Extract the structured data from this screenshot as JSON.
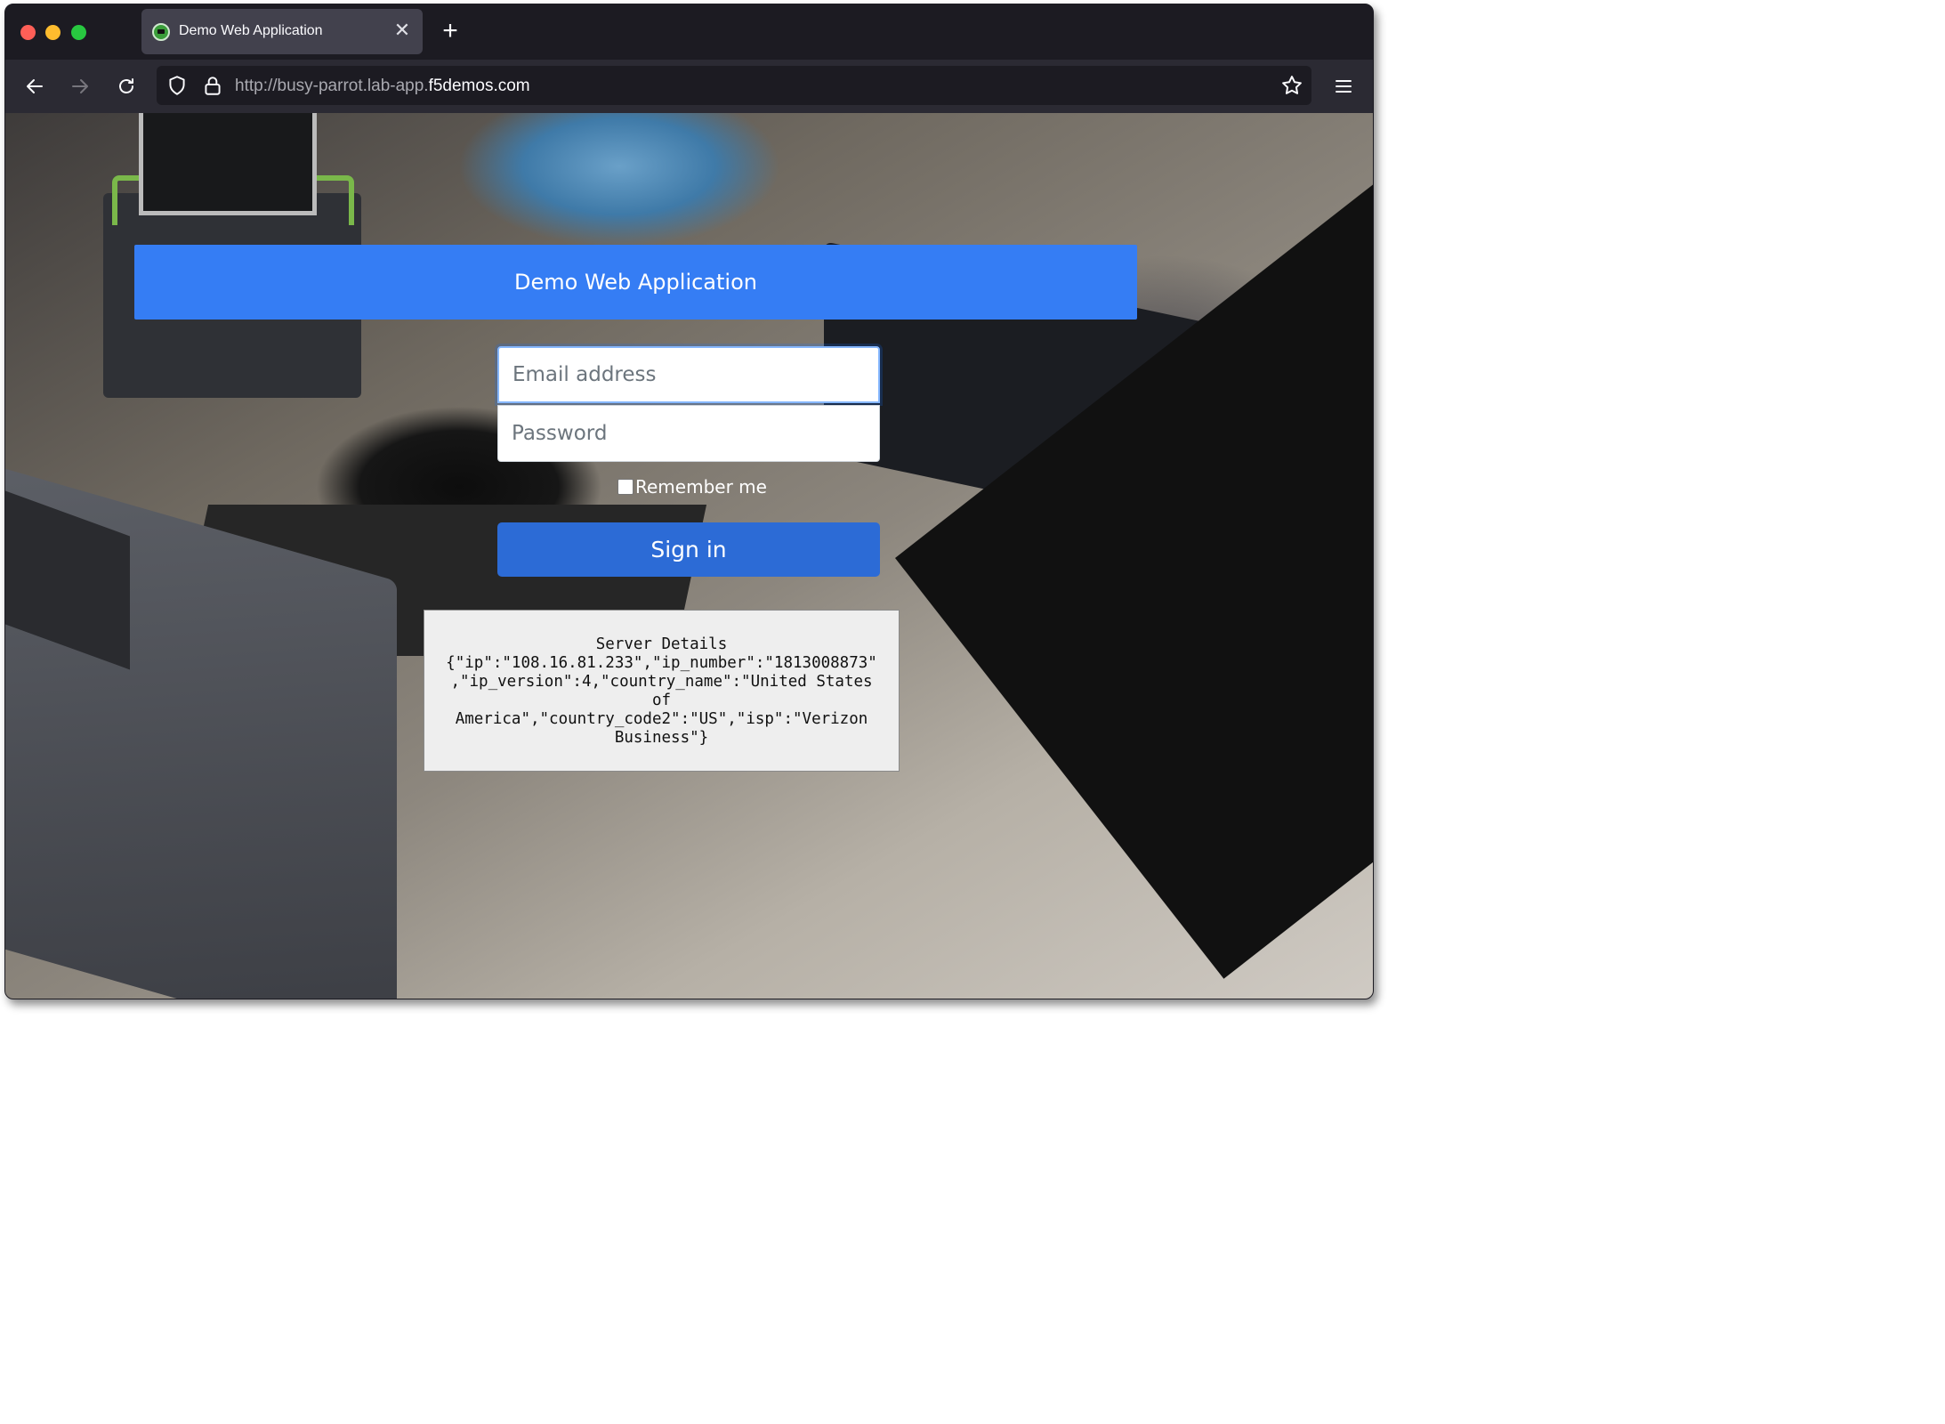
{
  "browser": {
    "tab": {
      "title": "Demo Web Application",
      "close_symbol": "✕"
    },
    "new_tab_symbol": "+",
    "url": {
      "prefix": "http://busy-parrot.lab-app.",
      "host": "f5demos.com"
    }
  },
  "page": {
    "banner_title": "Demo Web Application",
    "email_placeholder": "Email address",
    "password_placeholder": "Password",
    "remember_label": "Remember me",
    "signin_label": "Sign in",
    "server_details_label": "Server Details",
    "server_details_json": "{\"ip\":\"108.16.81.233\",\"ip_number\":\"1813008873\",\"ip_version\":4,\"country_name\":\"United States of America\",\"country_code2\":\"US\",\"isp\":\"Verizon Business\"}"
  },
  "colors": {
    "banner": "#357df4",
    "signin_button": "#2c6bd6",
    "browser_chrome": "#2b2a33"
  }
}
